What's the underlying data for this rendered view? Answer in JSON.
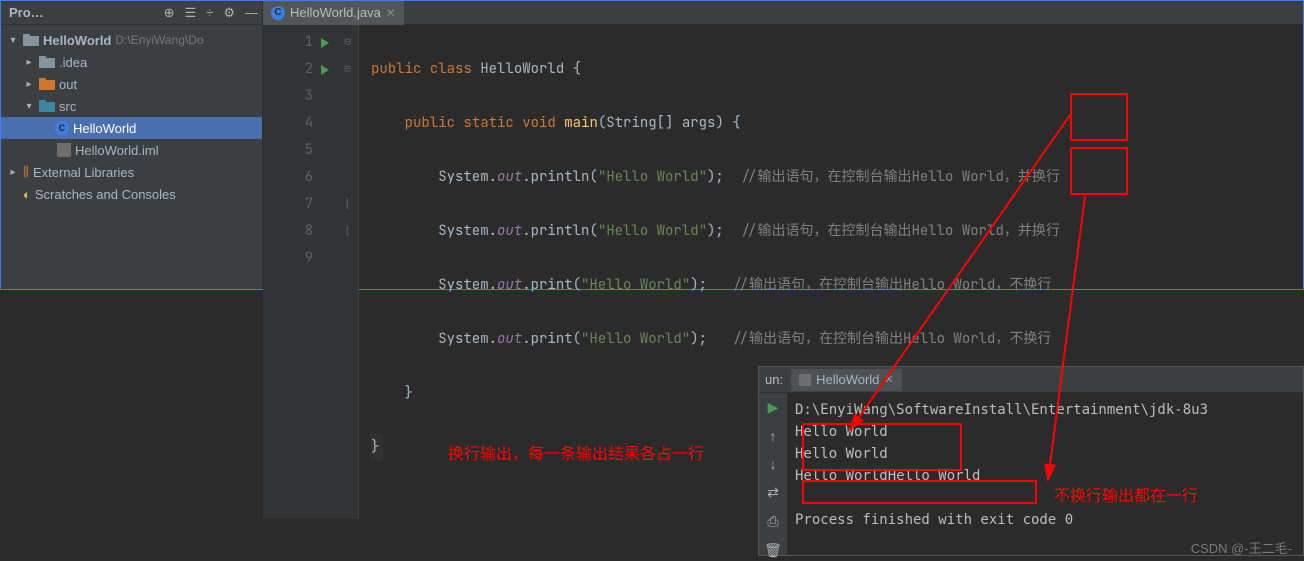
{
  "sidebar": {
    "title": "Pro…",
    "project_name": "HelloWorld",
    "project_path": "D:\\EnyiWang\\Do",
    "items": [
      {
        "label": ".idea"
      },
      {
        "label": "out"
      },
      {
        "label": "src"
      },
      {
        "label": "HelloWorld"
      },
      {
        "label": "HelloWorld.iml"
      }
    ],
    "external": "External Libraries",
    "scratches": "Scratches and Consoles"
  },
  "tab": {
    "file": "HelloWorld.java"
  },
  "code": {
    "l1a": "public",
    "l1b": "class",
    "l1c": "HelloWorld",
    "l1d": "{",
    "l2a": "public",
    "l2b": "static",
    "l2c": "void",
    "l2d": "main",
    "l2e": "(String[] args) {",
    "l3a": "System.",
    "l3b": "out",
    "l3c": ".println(",
    "l3d": "\"Hello World\"",
    "l3e": ");  ",
    "l3f": "//输出语句，在控制台输出Hello World，并换行",
    "l4a": "System.",
    "l4b": "out",
    "l4c": ".println(",
    "l4d": "\"Hello World\"",
    "l4e": ");  ",
    "l4f": "//输出语句，在控制台输出Hello World，并换行",
    "l5a": "System.",
    "l5b": "out",
    "l5c": ".print(",
    "l5d": "\"Hello World\"",
    "l5e": ");   ",
    "l5f": "//输出语句，在控制台输出Hello World，不换行",
    "l6a": "System.",
    "l6b": "out",
    "l6c": ".print(",
    "l6d": "\"Hello World\"",
    "l6e": ");   ",
    "l6f": "//输出语句，在控制台输出Hello World，不换行",
    "l7": "}",
    "l8": "}"
  },
  "run": {
    "label": "un:",
    "tab": "HelloWorld",
    "line1": "D:\\EnyiWang\\SoftwareInstall\\Entertainment\\jdk-8u3",
    "line2": "Hello World",
    "line3": "Hello World",
    "line4": "Hello WorldHello World",
    "line5": "Process finished with exit code 0"
  },
  "anno": {
    "left": "换行输出，每一条输出结果各占一行",
    "right": "不换行输出都在一行"
  },
  "watermark": "CSDN @-王二毛-"
}
